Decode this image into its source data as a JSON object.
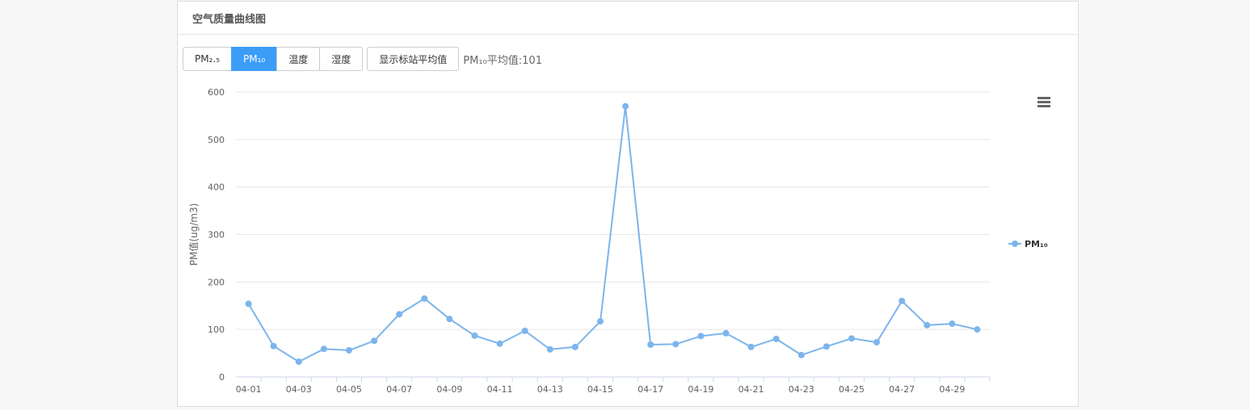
{
  "panel": {
    "title": "空气质量曲线图"
  },
  "toolbar": {
    "tabs": [
      {
        "label": "PM₂.₅",
        "active": false
      },
      {
        "label": "PM₁₀",
        "active": true
      },
      {
        "label": "温度",
        "active": false
      },
      {
        "label": "湿度",
        "active": false
      }
    ],
    "show_avg_label": "显示标站平均值",
    "avg_text": "PM₁₀平均值:101"
  },
  "chart_data": {
    "type": "line",
    "ylabel": "PM值(ug/m3)",
    "ylim": [
      0,
      600
    ],
    "yticks": [
      0,
      100,
      200,
      300,
      400,
      500,
      600
    ],
    "x": [
      "04-01",
      "04-02",
      "04-03",
      "04-04",
      "04-05",
      "04-06",
      "04-07",
      "04-08",
      "04-09",
      "04-10",
      "04-11",
      "04-12",
      "04-13",
      "04-14",
      "04-15",
      "04-16",
      "04-17",
      "04-18",
      "04-19",
      "04-20",
      "04-21",
      "04-22",
      "04-23",
      "04-24",
      "04-25",
      "04-26",
      "04-27",
      "04-28",
      "04-29",
      "04-30"
    ],
    "xtick_labels": [
      "04-01",
      "04-03",
      "04-05",
      "04-07",
      "04-09",
      "04-11",
      "04-13",
      "04-15",
      "04-17",
      "04-19",
      "04-21",
      "04-23",
      "04-25",
      "04-27",
      "04-29"
    ],
    "series": [
      {
        "name": "PM₁₀",
        "color": "#7cb5ec",
        "values": [
          154,
          65,
          32,
          59,
          56,
          76,
          132,
          165,
          122,
          87,
          70,
          97,
          58,
          63,
          117,
          570,
          68,
          69,
          86,
          92,
          63,
          80,
          46,
          64,
          81,
          73,
          160,
          109,
          112,
          100
        ]
      }
    ],
    "legend_position": "right",
    "grid": true
  },
  "icons": {
    "menu": "hamburger-menu-icon"
  }
}
